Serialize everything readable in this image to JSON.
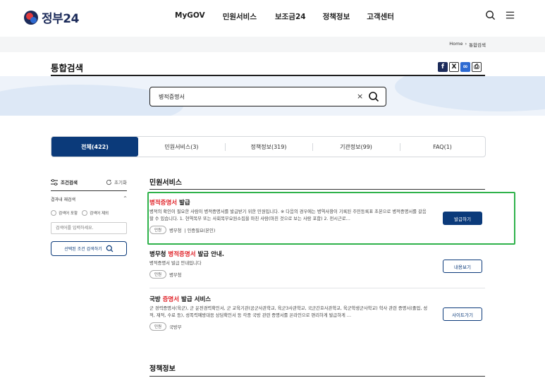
{
  "header": {
    "logo_text": "정부24",
    "nav": [
      "MyGOV",
      "민원서비스",
      "보조금24",
      "정책정보",
      "고객센터"
    ]
  },
  "breadcrumb": [
    "Home",
    "›",
    "통합검색"
  ],
  "page": {
    "title": "통합검색"
  },
  "search": {
    "value": "병적증명서",
    "clear_symbol": "×"
  },
  "tabs": [
    {
      "label": "전체(422)"
    },
    {
      "label": "민원서비스(3)"
    },
    {
      "label": "정책정보(319)"
    },
    {
      "label": "기관정보(99)"
    },
    {
      "label": "FAQ(1)"
    }
  ],
  "filter": {
    "title": "조건검색",
    "reset": "초기화",
    "refine_title": "결과내 재검색",
    "refine_toggle": "^",
    "include": "검색어 포함",
    "exclude": "검색어 제외",
    "input_placeholder": "검색어를 입력하세요.",
    "button": "선택된 조건 검색하기"
  },
  "civil": {
    "section_title": "민원서비스",
    "results": [
      {
        "title_hl": "병적증명서",
        "title_rest": " 발급",
        "desc": "병적의 확인이 필요한 사람이 병적증명서를 발급받기 위한 민원입니다. ※ 다음의 경우에는 병역사항이 기록된 주민등록표 초본으로 병적증명서를 갈음할 수 있습니다. 1. 현역복무 또는 사회복무요원소집을 마친 사람(마친 것으로 보는 사람 포함) 2. 전시근로…",
        "badge": "민원",
        "org": "병무청",
        "extra": "| 인증필요(본인)",
        "button": "발급하기"
      },
      {
        "title_pre": "병무청 ",
        "title_hl": "병적증명서",
        "title_rest": " 발급 안내.",
        "desc": "병적증명서 발급 안내입니다",
        "badge": "민원",
        "org": "병무청",
        "button": "내용보기"
      },
      {
        "title_pre": "국방 ",
        "title_hl": "증명서",
        "title_rest": " 발급 서비스",
        "desc": "군 경력증명서(육군), 군 운전경력확인서, 군 교육기관(공군사관학교, 육군3사관학교, 국군간호사관학교, 육군학생군사학교) 학사 관련 증명서(졸업, 성적, 재적, 수료 등), 성폭력예방대응 상담확인서 등 각종 국방 관련 증명서를 온라인으로 편리하게 발급하게 …",
        "badge": "민원",
        "org": "국방부",
        "button": "사이트가기"
      }
    ]
  },
  "policy": {
    "section_title": "정책정보"
  },
  "colors": {
    "primary": "#0b3a7a",
    "highlight": "#e0242a",
    "selection": "#2fb24b"
  }
}
